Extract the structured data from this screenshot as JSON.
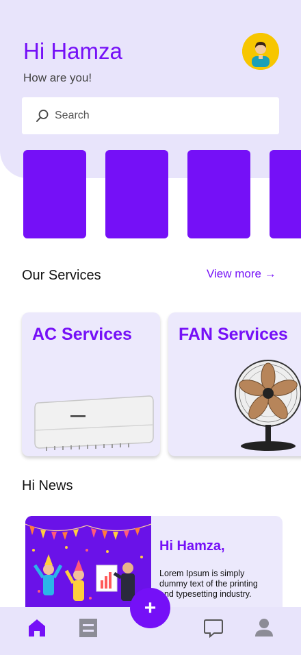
{
  "header": {
    "greeting": "Hi Hamza",
    "subtitle": "How are you!"
  },
  "search": {
    "placeholder": "Search"
  },
  "colors": {
    "accent": "#7510f7",
    "header_bg": "#e8e4fb",
    "card_bg": "#ece9fc"
  },
  "services": {
    "title": "Our Services",
    "view_more": "View more →",
    "items": [
      {
        "title": "AC Services",
        "icon": "air-conditioner-image"
      },
      {
        "title": "FAN Services",
        "icon": "table-fan-image"
      }
    ]
  },
  "news": {
    "title": "Hi News",
    "card": {
      "title": "Hi Hamza,",
      "body": "Lorem Ipsum is simply dummy text of the printing and typesetting industry."
    }
  },
  "fab": {
    "label": "+"
  },
  "nav": {
    "items": [
      "home-icon",
      "list-icon",
      "chat-icon",
      "profile-icon"
    ]
  }
}
